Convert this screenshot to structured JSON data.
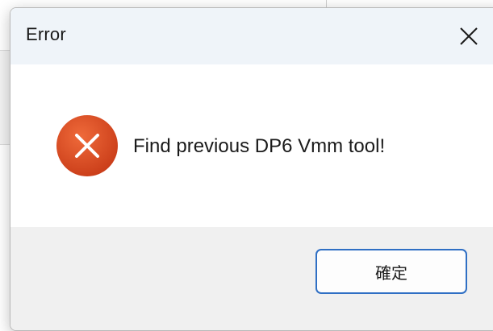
{
  "dialog": {
    "title": "Error",
    "message": "Find previous DP6 Vmm tool!",
    "ok_label": "確定",
    "icons": {
      "close": "close-icon",
      "error": "error-icon"
    }
  },
  "colors": {
    "titlebar_bg": "#eff4f9",
    "footer_bg": "#f0f0f0",
    "error_icon_red": "#d74a22",
    "button_border": "#2f6fc4"
  }
}
